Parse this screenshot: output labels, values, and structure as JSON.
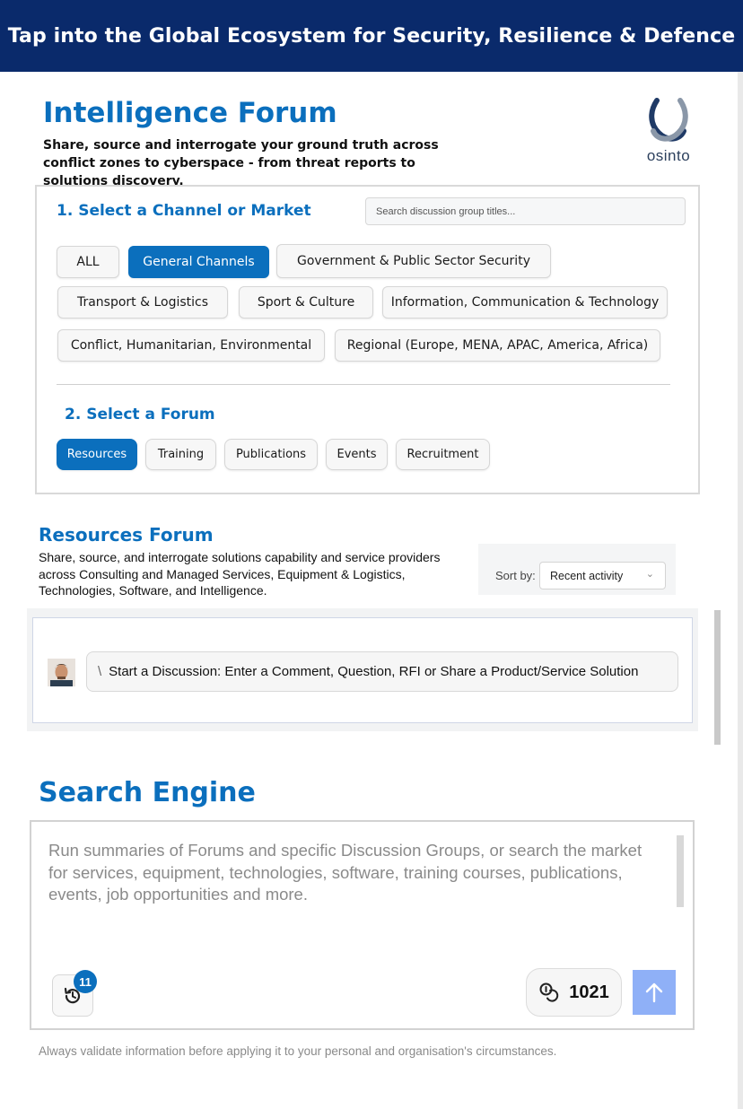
{
  "banner": {
    "title": "Tap into the Global Ecosystem for Security, Resilience & Defence"
  },
  "intel": {
    "title": "Intelligence Forum",
    "subtitle": "Share, source and interrogate your ground truth across conflict zones to cyberspace - from threat reports to solutions discovery.",
    "logo_text": "osinto"
  },
  "channels": {
    "heading": "1. Select a Channel or Market",
    "search_placeholder": "Search discussion group titles...",
    "items": [
      {
        "label": "ALL",
        "active": false
      },
      {
        "label": "General Channels",
        "active": true
      },
      {
        "label": "Government & Public Sector Security",
        "active": false
      },
      {
        "label": "Transport & Logistics",
        "active": false
      },
      {
        "label": "Sport & Culture",
        "active": false
      },
      {
        "label": "Information, Communication & Technology",
        "active": false
      },
      {
        "label": "Conflict, Humanitarian, Environmental",
        "active": false
      },
      {
        "label": "Regional (Europe, MENA, APAC, America, Africa)",
        "active": false
      }
    ]
  },
  "forums": {
    "heading": "2. Select a Forum",
    "items": [
      {
        "label": "Resources",
        "active": true
      },
      {
        "label": "Training",
        "active": false
      },
      {
        "label": "Publications",
        "active": false
      },
      {
        "label": "Events",
        "active": false
      },
      {
        "label": "Recruitment",
        "active": false
      }
    ]
  },
  "resources": {
    "title": "Resources Forum",
    "description": "Share, source, and interrogate solutions capability and service providers across Consulting and Managed Services, Equipment & Logistics, Technologies, Software, and Intelligence.",
    "sort_label": "Sort by:",
    "sort_value": "Recent activity"
  },
  "discussion": {
    "ghost_text": "\\",
    "placeholder": "Start a Discussion: Enter a Comment, Question, RFI or Share a Product/Service Solution"
  },
  "search_engine": {
    "title": "Search Engine",
    "placeholder": "Run summaries of Forums and specific Discussion Groups, or search the market for services, equipment, technologies, software, training courses, publications, events, job opportunities and more.",
    "history_count": "11",
    "credits": "1021"
  },
  "footer": {
    "note": "Always validate information before applying it to your personal and organisation's circumstances."
  },
  "colors": {
    "banner": "#0a2a6b",
    "accent": "#0b6fbd",
    "send": "#8fb0f7"
  },
  "icons": [
    "osinto-logo-icon",
    "avatar",
    "history-icon",
    "credits-icon",
    "arrow-up-icon",
    "chevron-down-icon"
  ]
}
